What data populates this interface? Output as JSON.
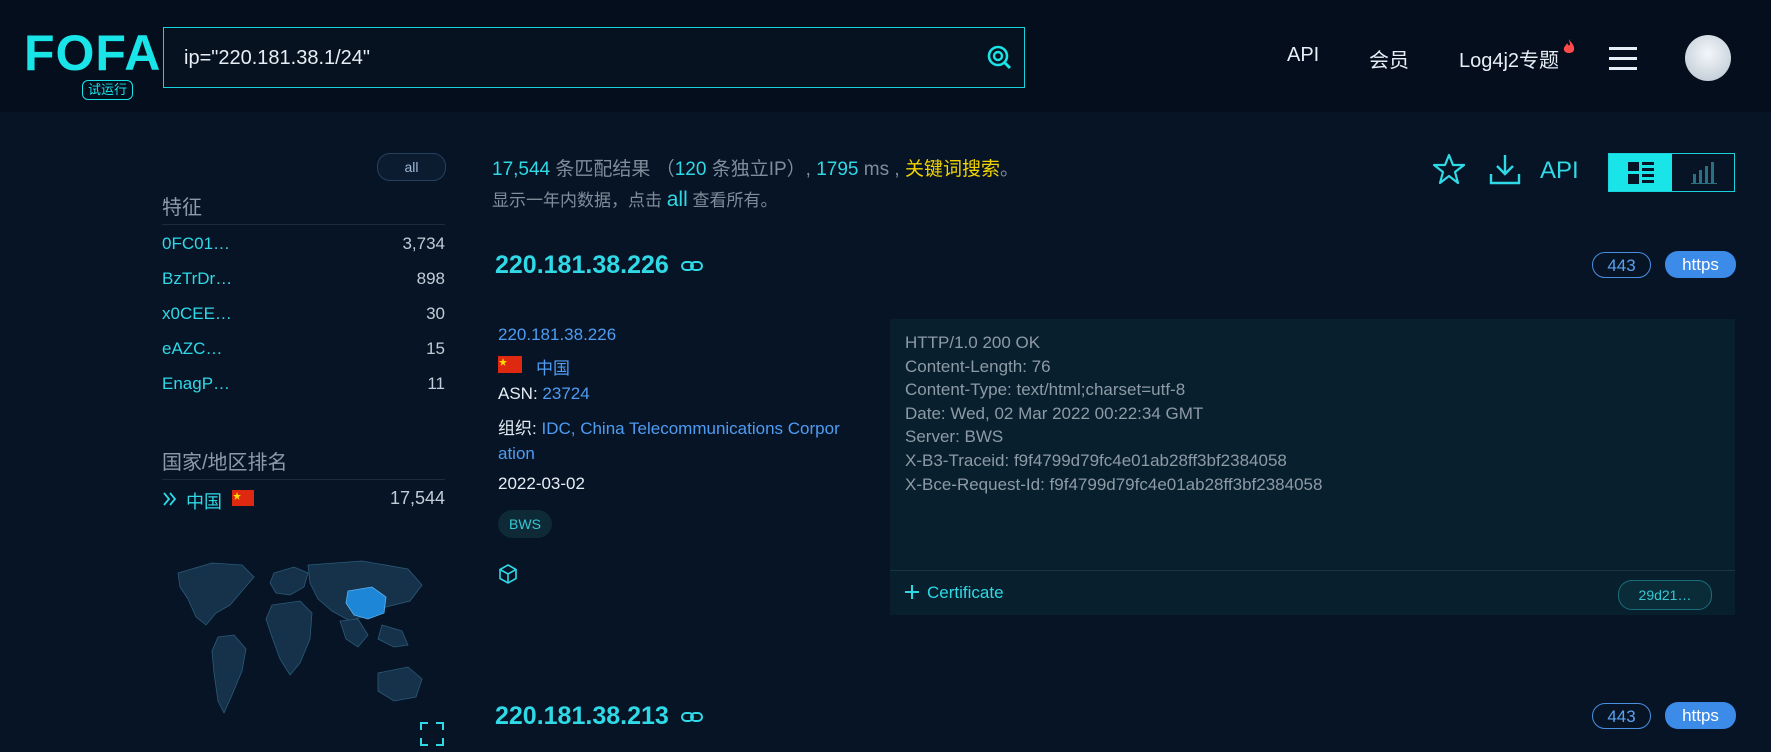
{
  "header": {
    "logo_text": "FOFA",
    "logo_badge": "试运行",
    "search_query": "ip=\"220.181.38.1/24\"",
    "nav": [
      "API",
      "会员",
      "Log4j2专题"
    ],
    "colors": {
      "accent": "#19e4e8",
      "background": "#061426",
      "link": "#4f9cf3",
      "highlight": "#f2d400"
    }
  },
  "sidebar": {
    "all_label": "all",
    "features_title": "特征",
    "features": [
      {
        "name": "0FC01…",
        "count": "3,734"
      },
      {
        "name": "BzTrDr…",
        "count": "898"
      },
      {
        "name": "x0CEE…",
        "count": "30"
      },
      {
        "name": "eAZC…",
        "count": "15"
      },
      {
        "name": "EnagP…",
        "count": "11"
      }
    ],
    "country_title": "国家/地区排名",
    "countries": [
      {
        "name": "中国",
        "count": "17,544",
        "flag": "cn-flag"
      }
    ]
  },
  "summary": {
    "results": "17,544",
    "results_label": "条匹配结果",
    "unique_open": "（",
    "unique_ip": "120",
    "unique_label": "条独立IP）,",
    "time": "1795",
    "time_unit": "ms ,",
    "keyword_link": "关键词搜索",
    "end": "。",
    "line2_pre": "显示一年内数据，点击",
    "line2_link": "all",
    "line2_post": "查看所有。"
  },
  "toolbar": {
    "api_label": "API",
    "icons": [
      "star-icon",
      "download-icon",
      "list-view-icon",
      "chart-view-icon"
    ]
  },
  "results": [
    {
      "ip": "220.181.38.226",
      "port": "443",
      "protocol": "https",
      "ip_link": "220.181.38.226",
      "country": "中国",
      "asn_label": "ASN:",
      "asn": "23724",
      "org_label": "组织:",
      "org_line1": "IDC, China Telecommunications Corpor",
      "org_line2": "ation",
      "date": "2022-03-02",
      "tag": "BWS",
      "banner": [
        "HTTP/1.0 200 OK",
        "Content-Length: 76",
        "Content-Type: text/html;charset=utf-8",
        "Date: Wed, 02 Mar 2022 00:22:34 GMT",
        "Server: BWS",
        "X-B3-Traceid: f9f4799d79fc4e01ab28ff3bf2384058",
        "X-Bce-Request-Id: f9f4799d79fc4e01ab28ff3bf2384058"
      ],
      "certificate_label": "Certificate",
      "certificate_hash": "29d21…"
    },
    {
      "ip": "220.181.38.213",
      "port": "443",
      "protocol": "https"
    }
  ]
}
